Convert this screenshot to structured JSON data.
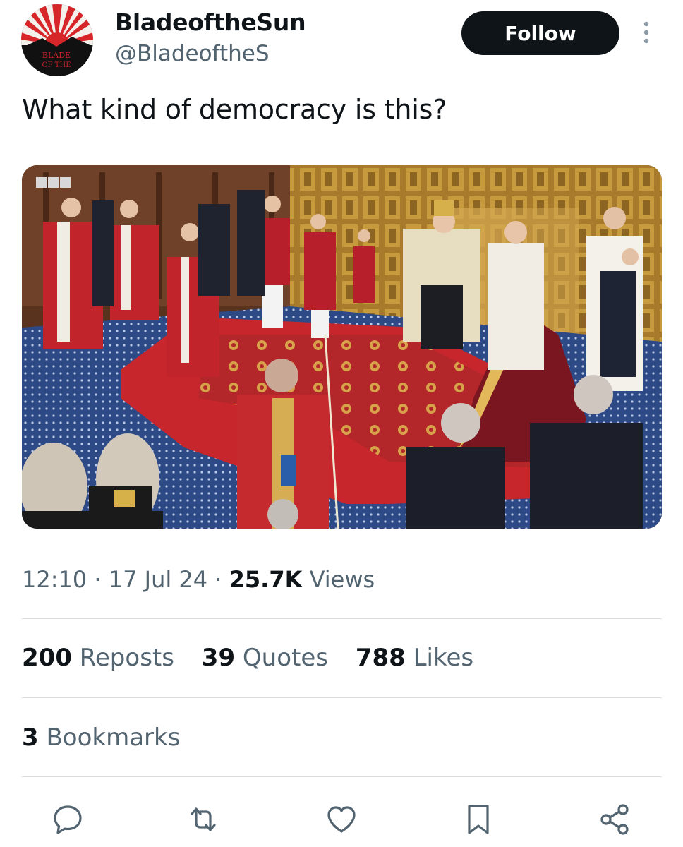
{
  "author": {
    "display_name": "BladeoftheSun",
    "handle": "@BladeoftheS",
    "avatar_text": "BLADE OF THE SUN"
  },
  "follow_label": "Follow",
  "tweet": {
    "text": "What kind of democracy is this?",
    "image_watermark": "BBC"
  },
  "meta": {
    "time": "12:10",
    "sep1": "·",
    "date": "17 Jul 24",
    "sep2": "·",
    "views_count": "25.7K",
    "views_label": "Views"
  },
  "stats": {
    "reposts_count": "200",
    "reposts_label": "Reposts",
    "quotes_count": "39",
    "quotes_label": "Quotes",
    "likes_count": "788",
    "likes_label": "Likes",
    "bookmarks_count": "3",
    "bookmarks_label": "Bookmarks"
  },
  "icons": {
    "reply": "reply-icon",
    "repost": "repost-icon",
    "like": "heart-icon",
    "bookmark": "bookmark-icon",
    "share": "share-icon",
    "more": "more-vertical-icon"
  },
  "colors": {
    "text_primary": "#0f1419",
    "text_secondary": "#536471",
    "follow_bg": "#0f1419",
    "divider": "#d9dde0"
  }
}
